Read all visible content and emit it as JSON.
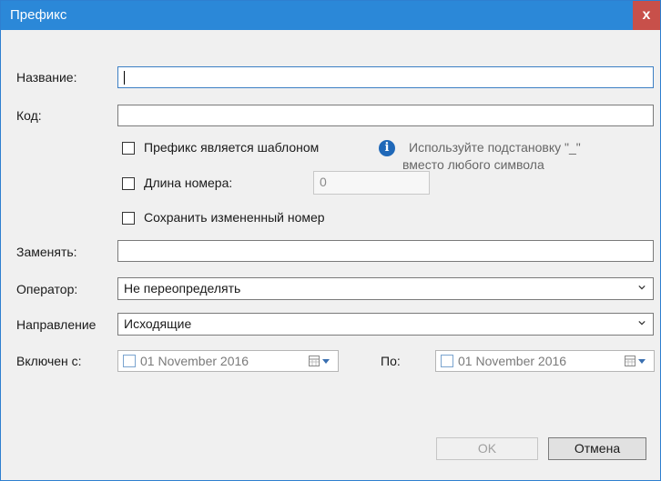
{
  "window": {
    "title": "Префикс",
    "close_label": "x"
  },
  "form": {
    "name_label": "Название:",
    "name_value": "",
    "code_label": "Код:",
    "code_value": "",
    "template_checkbox_label": "Префикс является шаблоном",
    "template_checked": false,
    "hint_line1": "Используйте подстановку \"_\"",
    "hint_line2": "вместо любого символа",
    "length_checkbox_label": "Длина номера:",
    "length_checked": false,
    "length_value": "0",
    "keep_changed_label": "Сохранить измененный номер",
    "keep_changed_checked": false,
    "replace_label": "Заменять:",
    "replace_value": "",
    "operator_label": "Оператор:",
    "operator_value": "Не переопределять",
    "direction_label": "Направление",
    "direction_value": "Исходящие",
    "enabled_from_label": "Включен с:",
    "enabled_from_value": "01 November 2016",
    "to_label": "По:",
    "to_value": "01 November 2016"
  },
  "buttons": {
    "ok_label": "OK",
    "cancel_label": "Отмена"
  },
  "icons": {
    "info": "info-icon",
    "calendar": "calendar-icon",
    "dropdown": "chevron-down-icon"
  },
  "colors": {
    "titlebar": "#2b88d8",
    "close": "#c8504a",
    "focus_border": "#3c7fc4"
  }
}
